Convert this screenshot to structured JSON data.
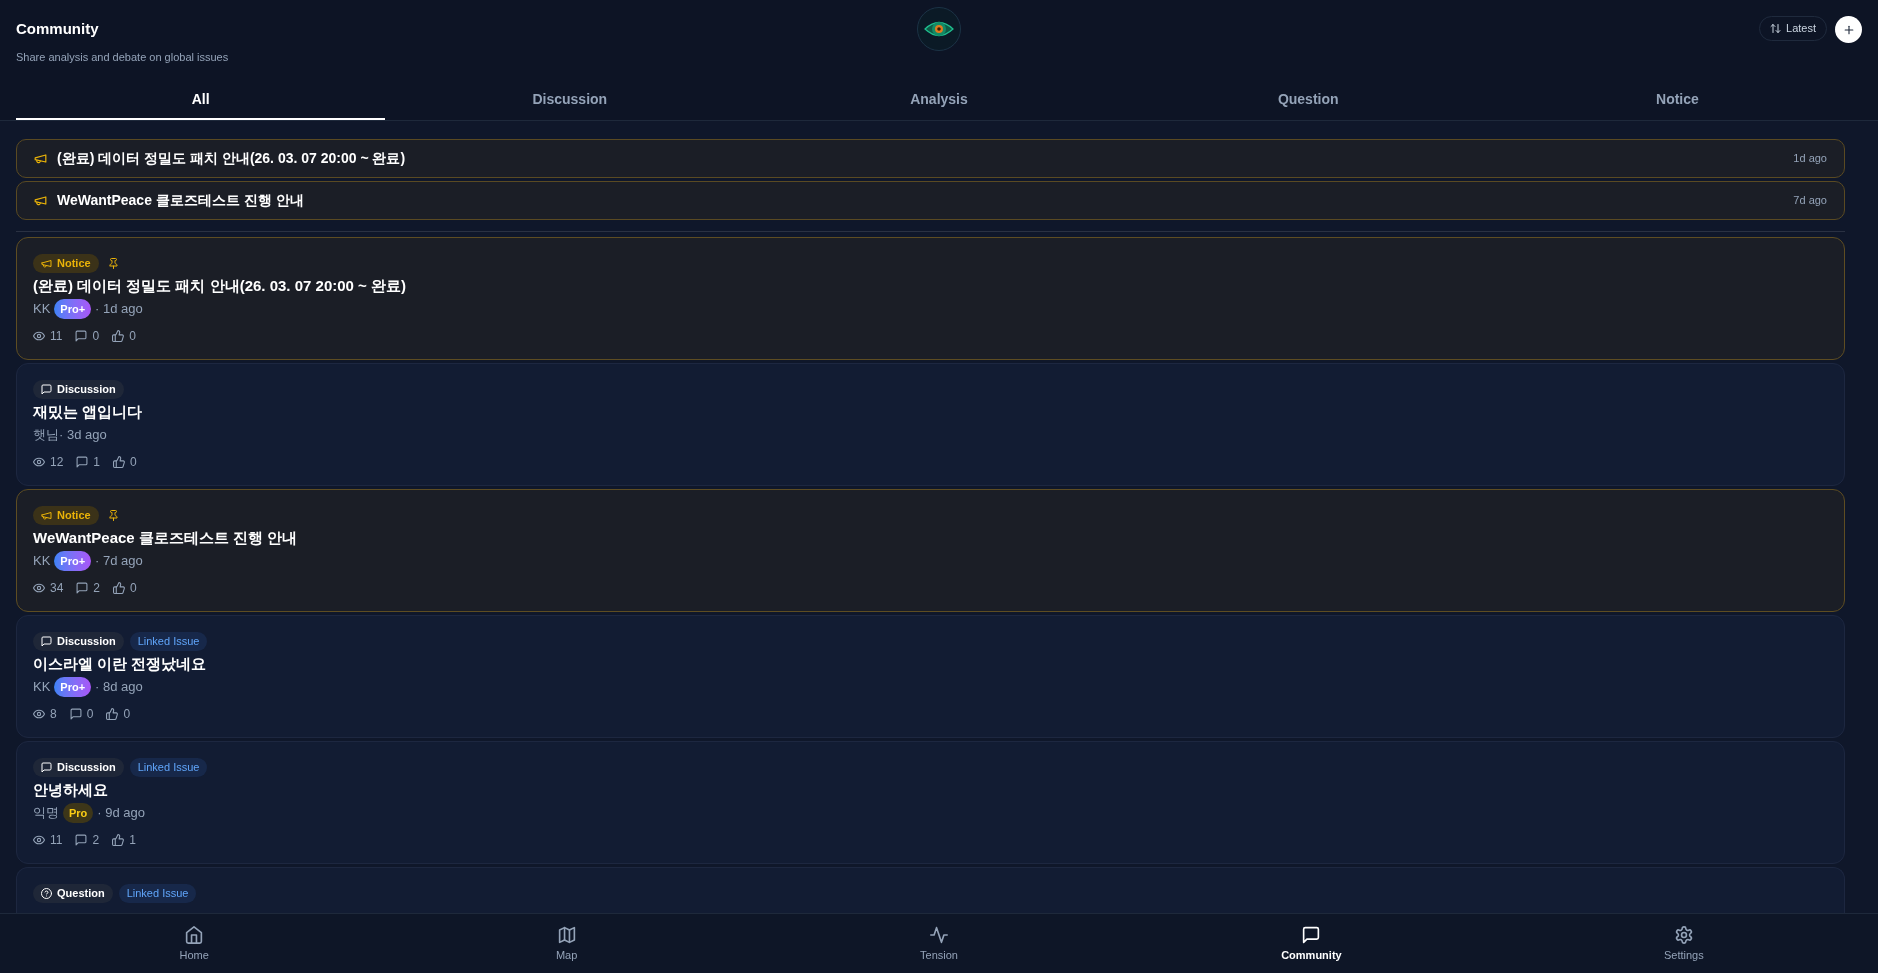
{
  "header": {
    "title": "Community",
    "subtitle": "Share analysis and debate on global issues",
    "sort_button": {
      "label": "Latest"
    }
  },
  "tabs": [
    {
      "label": "All",
      "selected": true
    },
    {
      "label": "Discussion",
      "selected": false
    },
    {
      "label": "Analysis",
      "selected": false
    },
    {
      "label": "Question",
      "selected": false
    },
    {
      "label": "Notice",
      "selected": false
    }
  ],
  "pinned_notices": [
    {
      "title": "(완료) 데이터 정밀도 패치 안내(26. 03. 07 20:00 ~ 완료)",
      "time": "1d ago"
    },
    {
      "title": "WeWantPeace 클로즈테스트 진행 안내",
      "time": "7d ago"
    }
  ],
  "posts": [
    {
      "kind": "notice",
      "category": "Notice",
      "pinned": true,
      "title": "(완료) 데이터 정밀도 패치 안내(26. 03. 07 20:00 ~ 완료)",
      "author": "KK",
      "tier": {
        "kind": "pro_plus",
        "label": "Pro+"
      },
      "time": "· 1d ago",
      "views": "11",
      "comments": "0",
      "likes": "0"
    },
    {
      "kind": "discussion",
      "category": "Discussion",
      "pinned": false,
      "title": "재밌는 앱입니다",
      "author": "햇님",
      "time": "· 3d ago",
      "views": "12",
      "comments": "1",
      "likes": "0"
    },
    {
      "kind": "notice",
      "category": "Notice",
      "pinned": true,
      "title": "WeWantPeace 클로즈테스트 진행 안내",
      "author": "KK",
      "tier": {
        "kind": "pro_plus",
        "label": "Pro+"
      },
      "time": "· 7d ago",
      "views": "34",
      "comments": "2",
      "likes": "0"
    },
    {
      "kind": "discussion",
      "category": "Discussion",
      "pinned": false,
      "tags": [
        "Linked Issue"
      ],
      "title": "이스라엘 이란 전쟁났네요",
      "author": "KK",
      "tier": {
        "kind": "pro_plus",
        "label": "Pro+"
      },
      "time": "· 8d ago",
      "views": "8",
      "comments": "0",
      "likes": "0"
    },
    {
      "kind": "discussion",
      "category": "Discussion",
      "pinned": false,
      "tags": [
        "Linked Issue"
      ],
      "title": "안녕하세요",
      "author": "익명",
      "tier": {
        "kind": "pro",
        "label": "Pro"
      },
      "time": "· 9d ago",
      "views": "11",
      "comments": "2",
      "likes": "1"
    },
    {
      "kind": "question",
      "category": "Question",
      "pinned": false,
      "tags": [
        "Linked Issue"
      ]
    }
  ],
  "bottom_nav": [
    {
      "label": "Home",
      "selected": false
    },
    {
      "label": "Map",
      "selected": false
    },
    {
      "label": "Tension",
      "selected": false
    },
    {
      "label": "Community",
      "selected": true
    },
    {
      "label": "Settings",
      "selected": false
    }
  ]
}
